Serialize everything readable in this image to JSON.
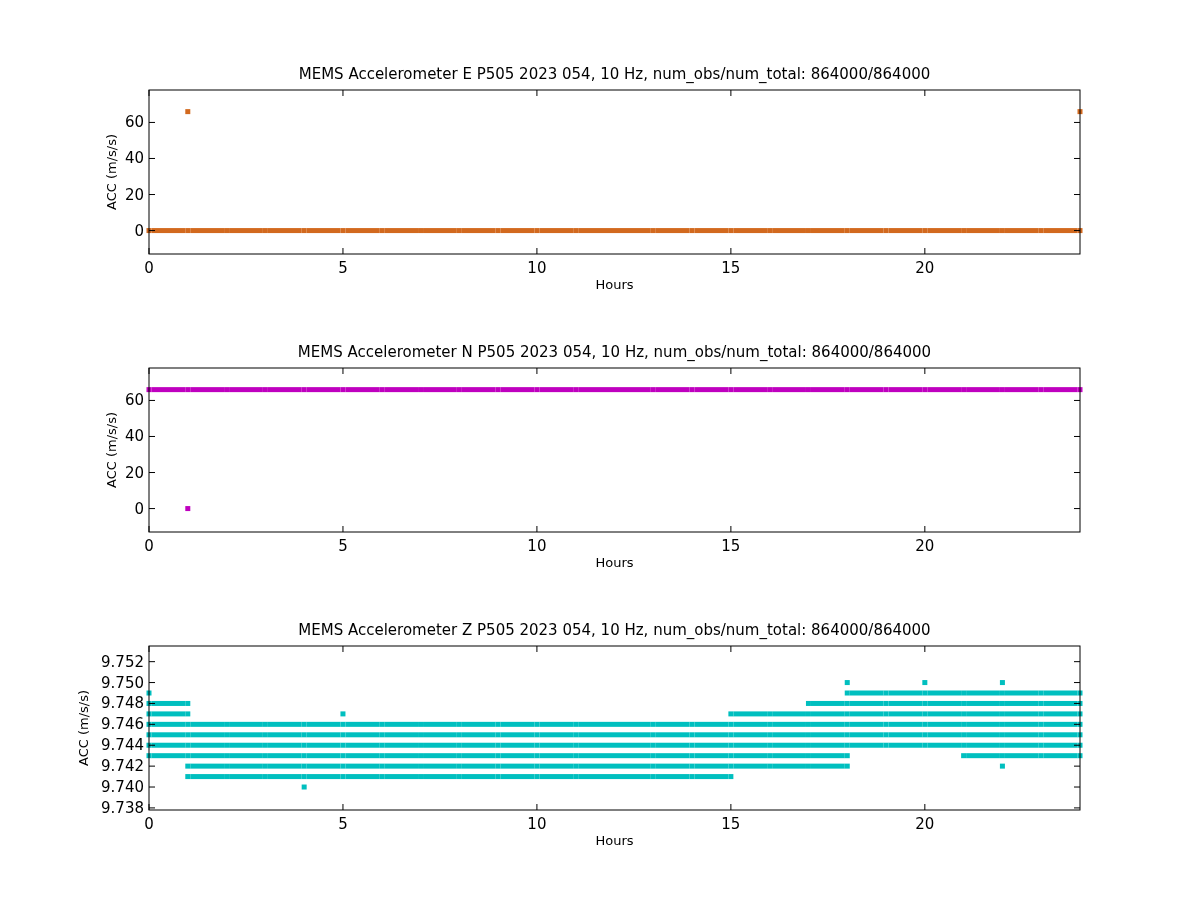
{
  "charts": [
    {
      "chart_data": {
        "type": "scatter",
        "title": "MEMS Accelerometer E P505 2023 054, 10 Hz, num_obs/num_total: 864000/864000",
        "xlabel": "Hours",
        "ylabel": "ACC (m/s/s)",
        "x": [
          0,
          1,
          2,
          3,
          4,
          5,
          6,
          7,
          8,
          9,
          10,
          11,
          12,
          13,
          14,
          15,
          16,
          17,
          18,
          19,
          20,
          21,
          22,
          23,
          24
        ],
        "xlim": [
          0,
          24
        ],
        "ylim": [
          -13,
          78
        ],
        "xticks": [
          0,
          5,
          10,
          15,
          20
        ],
        "yticks": [
          0,
          20,
          40,
          60
        ],
        "series": [
          {
            "color": "#d2691e",
            "values": [
              0,
              0,
              0,
              0,
              0,
              0,
              0,
              0,
              0,
              0,
              0,
              0,
              0,
              0,
              0,
              0,
              0,
              0,
              0,
              0,
              0,
              0,
              0,
              0,
              0
            ]
          },
          {
            "color": "#d2691e",
            "values": [
              null,
              66,
              null,
              null,
              null,
              null,
              null,
              null,
              null,
              null,
              null,
              null,
              null,
              null,
              null,
              null,
              null,
              null,
              null,
              null,
              null,
              null,
              null,
              null,
              66
            ]
          }
        ]
      }
    },
    {
      "chart_data": {
        "type": "scatter",
        "title": "MEMS Accelerometer N P505 2023 054, 10 Hz, num_obs/num_total: 864000/864000",
        "xlabel": "Hours",
        "ylabel": "ACC (m/s/s)",
        "x": [
          0,
          1,
          2,
          3,
          4,
          5,
          6,
          7,
          8,
          9,
          10,
          11,
          12,
          13,
          14,
          15,
          16,
          17,
          18,
          19,
          20,
          21,
          22,
          23,
          24
        ],
        "xlim": [
          0,
          24
        ],
        "ylim": [
          -13,
          78
        ],
        "xticks": [
          0,
          5,
          10,
          15,
          20
        ],
        "yticks": [
          0,
          20,
          40,
          60
        ],
        "series": [
          {
            "color": "#bf00bf",
            "values": [
              66,
              66,
              66,
              66,
              66,
              66,
              66,
              66,
              66,
              66,
              66,
              66,
              66,
              66,
              66,
              66,
              66,
              66,
              66,
              66,
              66,
              66,
              66,
              66,
              66
            ]
          },
          {
            "color": "#bf00bf",
            "values": [
              null,
              0,
              null,
              null,
              null,
              null,
              null,
              null,
              null,
              null,
              null,
              null,
              null,
              null,
              null,
              null,
              null,
              null,
              null,
              null,
              null,
              null,
              null,
              null,
              null
            ]
          }
        ]
      }
    },
    {
      "chart_data": {
        "type": "scatter",
        "title": "MEMS Accelerometer Z P505 2023 054, 10 Hz, num_obs/num_total: 864000/864000",
        "xlabel": "Hours",
        "ylabel": "ACC (m/s/s)",
        "x": [
          0,
          1,
          2,
          3,
          4,
          5,
          6,
          7,
          8,
          9,
          10,
          11,
          12,
          13,
          14,
          15,
          16,
          17,
          18,
          19,
          20,
          21,
          22,
          23,
          24
        ],
        "xlim": [
          0,
          24
        ],
        "ylim": [
          9.7378,
          9.7535
        ],
        "xticks": [
          0,
          5,
          10,
          15,
          20
        ],
        "yticks": [
          {
            "value": 9.738,
            "label": "9.738"
          },
          {
            "value": 9.74,
            "label": "9.740"
          },
          {
            "value": 9.742,
            "label": "9.742"
          },
          {
            "value": 9.744,
            "label": "9.744"
          },
          {
            "value": 9.746,
            "label": "9.746"
          },
          {
            "value": 9.748,
            "label": "9.748"
          },
          {
            "value": 9.75,
            "label": "9.750"
          },
          {
            "value": 9.752,
            "label": "9.752"
          }
        ],
        "series": [
          {
            "color": "#00bfbf",
            "values": [
              null,
              null,
              null,
              null,
              null,
              null,
              null,
              null,
              null,
              null,
              null,
              null,
              null,
              null,
              null,
              null,
              null,
              null,
              9.75,
              null,
              9.75,
              null,
              9.75,
              null,
              null
            ]
          },
          {
            "color": "#00bfbf",
            "values": [
              9.749,
              null,
              null,
              null,
              null,
              null,
              null,
              null,
              null,
              null,
              null,
              null,
              null,
              null,
              null,
              null,
              null,
              null,
              9.749,
              9.749,
              9.749,
              9.749,
              9.749,
              9.749,
              9.749
            ]
          },
          {
            "color": "#00bfbf",
            "values": [
              9.748,
              9.748,
              null,
              null,
              null,
              null,
              null,
              null,
              null,
              null,
              null,
              null,
              null,
              null,
              null,
              null,
              null,
              9.748,
              9.748,
              9.748,
              9.748,
              9.748,
              9.748,
              9.748,
              9.748
            ]
          },
          {
            "color": "#00bfbf",
            "values": [
              9.747,
              9.747,
              null,
              null,
              null,
              9.747,
              null,
              null,
              null,
              null,
              null,
              null,
              null,
              null,
              null,
              9.747,
              9.747,
              9.747,
              9.747,
              9.747,
              9.747,
              9.747,
              9.747,
              9.747,
              9.747
            ]
          },
          {
            "color": "#00bfbf",
            "values": [
              9.746,
              9.746,
              9.746,
              9.746,
              9.746,
              9.746,
              9.746,
              9.746,
              9.746,
              9.746,
              9.746,
              9.746,
              9.746,
              9.746,
              9.746,
              9.746,
              9.746,
              9.746,
              9.746,
              9.746,
              9.746,
              9.746,
              9.746,
              9.746,
              9.746
            ]
          },
          {
            "color": "#00bfbf",
            "values": [
              9.745,
              9.745,
              9.745,
              9.745,
              9.745,
              9.745,
              9.745,
              9.745,
              9.745,
              9.745,
              9.745,
              9.745,
              9.745,
              9.745,
              9.745,
              9.745,
              9.745,
              9.745,
              9.745,
              9.745,
              9.745,
              9.745,
              9.745,
              9.745,
              9.745
            ]
          },
          {
            "color": "#00bfbf",
            "values": [
              9.744,
              9.744,
              9.744,
              9.744,
              9.744,
              9.744,
              9.744,
              9.744,
              9.744,
              9.744,
              9.744,
              9.744,
              9.744,
              9.744,
              9.744,
              9.744,
              9.744,
              9.744,
              9.744,
              9.744,
              9.744,
              9.744,
              9.744,
              9.744,
              9.744
            ]
          },
          {
            "color": "#00bfbf",
            "values": [
              9.743,
              9.743,
              9.743,
              9.743,
              9.743,
              9.743,
              9.743,
              9.743,
              9.743,
              9.743,
              9.743,
              9.743,
              9.743,
              9.743,
              9.743,
              9.743,
              9.743,
              9.743,
              9.743,
              null,
              null,
              9.743,
              9.743,
              9.743,
              9.743
            ]
          },
          {
            "color": "#00bfbf",
            "values": [
              null,
              9.742,
              9.742,
              9.742,
              9.742,
              9.742,
              9.742,
              9.742,
              9.742,
              9.742,
              9.742,
              9.742,
              9.742,
              9.742,
              9.742,
              9.742,
              9.742,
              9.742,
              9.742,
              null,
              null,
              null,
              9.742,
              null,
              null
            ]
          },
          {
            "color": "#00bfbf",
            "values": [
              null,
              9.741,
              9.741,
              9.741,
              9.741,
              9.741,
              9.741,
              9.741,
              9.741,
              9.741,
              9.741,
              9.741,
              9.741,
              9.741,
              9.741,
              9.741,
              null,
              null,
              null,
              null,
              null,
              null,
              null,
              null,
              null
            ]
          },
          {
            "color": "#00bfbf",
            "values": [
              null,
              null,
              null,
              null,
              9.74,
              null,
              null,
              null,
              null,
              null,
              null,
              null,
              null,
              null,
              null,
              null,
              null,
              null,
              null,
              null,
              null,
              null,
              null,
              null,
              null
            ]
          }
        ]
      }
    }
  ]
}
